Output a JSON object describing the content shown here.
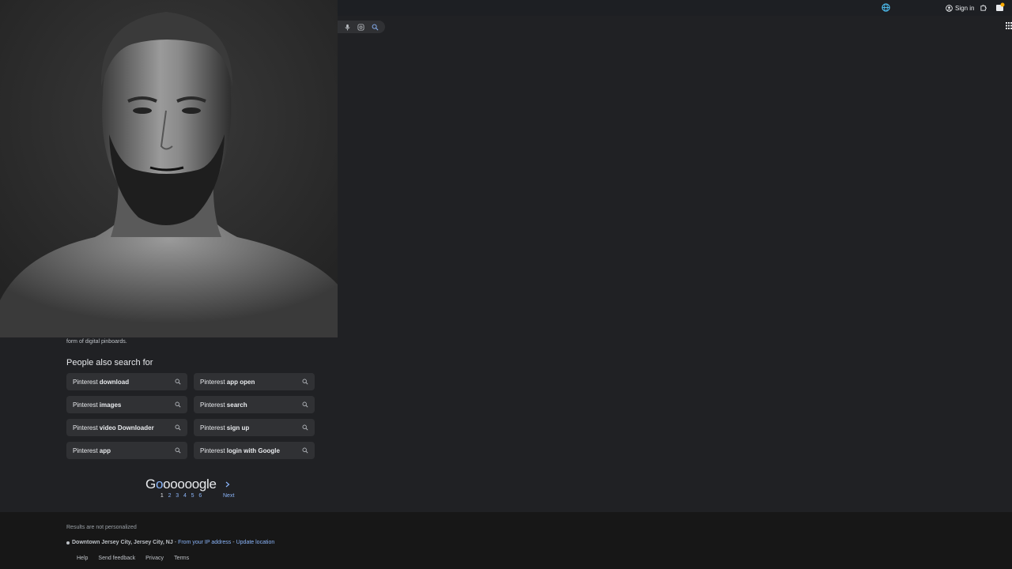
{
  "topbar": {
    "signin_label": "Sign in"
  },
  "result": {
    "snippet_tail": "form of digital pinboards."
  },
  "people_also_search": {
    "title": "People also search for",
    "items": [
      {
        "prefix": "Pinterest ",
        "bold": "download"
      },
      {
        "prefix": "Pinterest ",
        "bold": "app open"
      },
      {
        "prefix": "Pinterest ",
        "bold": "images"
      },
      {
        "prefix": "Pinterest ",
        "bold": "search"
      },
      {
        "prefix": "Pinterest ",
        "bold": "video Downloader"
      },
      {
        "prefix": "Pinterest ",
        "bold": "sign up"
      },
      {
        "prefix": "Pinterest ",
        "bold": "app"
      },
      {
        "prefix": "Pinterest ",
        "bold": "login with Google"
      }
    ]
  },
  "pagination": {
    "logo": "Goooooogle",
    "pages": [
      "1",
      "2",
      "3",
      "4",
      "5",
      "6"
    ],
    "current": "1",
    "next_label": "Next"
  },
  "footer": {
    "note": "Results are not personalized",
    "location": "Downtown Jersey City, Jersey City, NJ",
    "location_sep": " - ",
    "ip_link": "From your IP address",
    "sep2": " - ",
    "update_link": "Update location",
    "links": [
      "Help",
      "Send feedback",
      "Privacy",
      "Terms"
    ]
  },
  "colors": {
    "background": "#202124",
    "chip": "#303134",
    "link": "#8ab4f8",
    "footer": "#171717"
  }
}
